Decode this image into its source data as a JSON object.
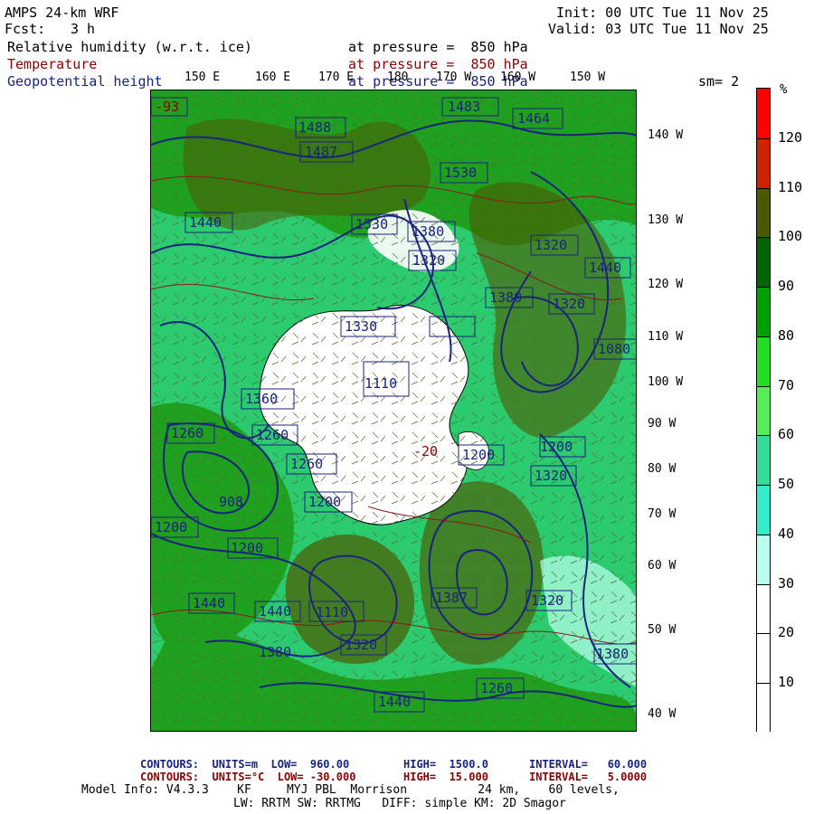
{
  "header": {
    "model": "AMPS 24-km WRF",
    "fcst_label": "Fcst:",
    "fcst_value": "3 h",
    "init": "Init: 00 UTC Tue 11 Nov 25",
    "valid": "Valid: 03 UTC Tue 11 Nov 25"
  },
  "fields": [
    {
      "name": "Relative humidity (w.r.t. ice)",
      "level": "at pressure =  850 hPa",
      "color": "#000000"
    },
    {
      "name": "Temperature",
      "level": "at pressure =  850 hPa",
      "color": "#8b0000"
    },
    {
      "name": "Geopotential height",
      "level": "at pressure =  850 hPa",
      "color": "#1a237e"
    }
  ],
  "smoothing": "sm= 2",
  "top_ticks": [
    "150 E",
    "160 E",
    "170 E",
    "180",
    "170 W",
    "160 W",
    "150 W"
  ],
  "right_ticks": [
    "140 W",
    "130 W",
    "120 W",
    "110 W",
    "100 W",
    "90 W",
    "80 W",
    "70 W",
    "60 W",
    "50 W",
    "40 W"
  ],
  "legend": {
    "unit": "%",
    "labels": [
      "120",
      "110",
      "100",
      "90",
      "80",
      "70",
      "60",
      "50",
      "40",
      "30",
      "20",
      "10"
    ],
    "colors": [
      "#ff0000",
      "#cc2200",
      "#4a5a00",
      "#006400",
      "#00a000",
      "#22dd22",
      "#55ee55",
      "#33dd99",
      "#33eecc",
      "#bbffee",
      "#ffffff",
      "#ffffff",
      "#ffffff"
    ]
  },
  "map_labels": [
    "-93",
    "1488",
    "1487",
    "1483",
    "1464",
    "1530",
    "1440",
    "1530",
    "1380",
    "1320",
    "1320",
    "1440",
    "1380",
    "1320",
    "1330",
    "1360",
    "1080",
    "1260",
    "1200",
    "1260",
    "1200",
    "1440",
    "1200",
    "1200",
    "1320",
    "1260",
    "1380",
    "1440",
    "1380",
    "1320",
    "1200",
    "1320",
    "1440",
    "-20",
    "908",
    "1110",
    "1110",
    "1387",
    "1260"
  ],
  "footer": {
    "line1": {
      "c1": "CONTOURS:  UNITS=m  LOW=  960.00",
      "c2": "HIGH=  1500.0",
      "c3": "INTERVAL=   60.000"
    },
    "line2": {
      "c1": "CONTOURS:  UNITS=°C  LOW= -30.000",
      "c2": "HIGH=  15.000",
      "c3": "INTERVAL=   5.0000"
    },
    "line3": "Model Info: V4.3.3    KF     MYJ PBL  Morrison          24 km,    60 levels,",
    "line4": "LW: RRTM SW: RRTMG   DIFF: simple KM: 2D Smagor"
  }
}
